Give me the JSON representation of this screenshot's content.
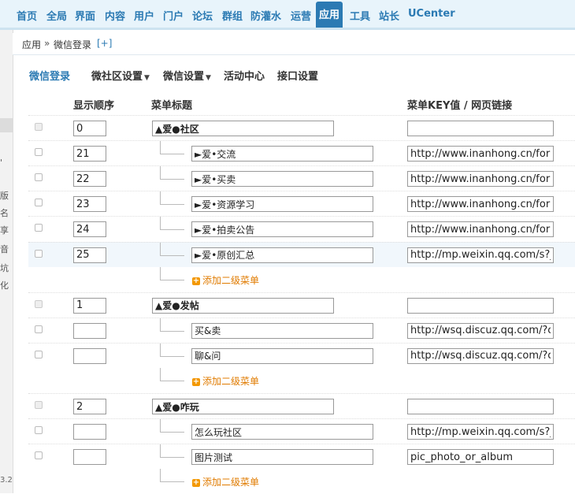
{
  "nav": {
    "items": [
      "首页",
      "全局",
      "界面",
      "内容",
      "用户",
      "门户",
      "论坛",
      "群组",
      "防灌水",
      "运营",
      "应用",
      "工具",
      "站长",
      "UCenter"
    ],
    "active": "应用"
  },
  "sidebar": {
    "fragments": [
      "'",
      "版",
      "名",
      "享",
      "音",
      "坑",
      "化"
    ],
    "version": "3.2"
  },
  "breadcrumb": {
    "home": "应用",
    "sep": "»",
    "current": "微信登录",
    "add": "[+]"
  },
  "subtabs": [
    {
      "label": "微信登录",
      "active": true,
      "dropdown": false
    },
    {
      "label": "微社区设置",
      "active": false,
      "dropdown": true
    },
    {
      "label": "微信设置",
      "active": false,
      "dropdown": true
    },
    {
      "label": "活动中心",
      "active": false,
      "dropdown": false
    },
    {
      "label": "接口设置",
      "active": false,
      "dropdown": false
    }
  ],
  "table": {
    "headers": {
      "order": "显示顺序",
      "title": "菜单标题",
      "key": "菜单KEY值 / 网页链接"
    },
    "add_sub_label": "添加二级菜单",
    "groups": [
      {
        "order": "0",
        "title": "▲爱●社区",
        "key": "",
        "children": [
          {
            "order": "21",
            "title": "►爱•交流",
            "key": "http://www.inanhong.cn/forum.php"
          },
          {
            "order": "22",
            "title": "►爱•买卖",
            "key": "http://www.inanhong.cn/forum.php"
          },
          {
            "order": "23",
            "title": "►爱•资源学习",
            "key": "http://www.inanhong.cn/forum.php"
          },
          {
            "order": "24",
            "title": "►爱•拍卖公告",
            "key": "http://www.inanhong.cn/forum.php"
          },
          {
            "order": "25",
            "title": "►爱•原创汇总",
            "key": "http://mp.weixin.qq.com/s?__biz"
          }
        ]
      },
      {
        "order": "1",
        "title": "▲爱●发帖",
        "key": "",
        "children": [
          {
            "order": "",
            "title": "买&卖",
            "key": "http://wsq.discuz.qq.com/?c=index"
          },
          {
            "order": "",
            "title": "聊&问",
            "key": "http://wsq.discuz.qq.com/?c=index"
          }
        ]
      },
      {
        "order": "2",
        "title": "▲爱●咋玩",
        "key": "",
        "children": [
          {
            "order": "",
            "title": "怎么玩社区",
            "key": "http://mp.weixin.qq.com/s?__biz"
          },
          {
            "order": "",
            "title": "图片测试",
            "key": "pic_photo_or_album"
          }
        ]
      }
    ]
  }
}
